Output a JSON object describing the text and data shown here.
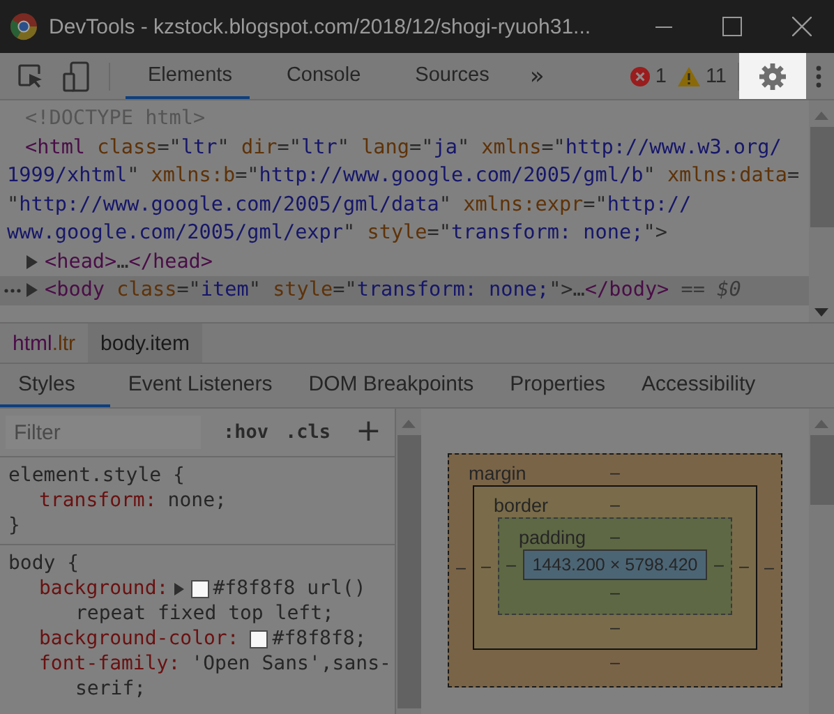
{
  "window": {
    "title": "DevTools - kzstock.blogspot.com/2018/12/shogi-ryuoh31..."
  },
  "toolbar": {
    "tabs": [
      {
        "label": "Elements",
        "selected": true
      },
      {
        "label": "Console",
        "selected": false
      },
      {
        "label": "Sources",
        "selected": false
      }
    ],
    "more": "»",
    "errors": "1",
    "warnings": "11",
    "settings_highlighted": true
  },
  "dom": [
    {
      "lines": [
        [
          {
            "kind": "doctype",
            "text": "<!DOCTYPE html>"
          }
        ]
      ]
    },
    {
      "lines": [
        [
          {
            "kind": "tag",
            "text": "<html "
          },
          {
            "kind": "attr",
            "text": "class"
          },
          {
            "kind": "punct",
            "text": "=\""
          },
          {
            "kind": "value",
            "text": "ltr"
          },
          {
            "kind": "punct",
            "text": "\" "
          },
          {
            "kind": "attr",
            "text": "dir"
          },
          {
            "kind": "punct",
            "text": "=\""
          },
          {
            "kind": "value",
            "text": "ltr"
          },
          {
            "kind": "punct",
            "text": "\" "
          },
          {
            "kind": "attr",
            "text": "lang"
          },
          {
            "kind": "punct",
            "text": "=\""
          },
          {
            "kind": "value",
            "text": "ja"
          },
          {
            "kind": "punct",
            "text": "\" "
          },
          {
            "kind": "attr",
            "text": "xmlns"
          },
          {
            "kind": "punct",
            "text": "=\""
          },
          {
            "kind": "value",
            "text": "http://www.w3.org/"
          }
        ],
        [
          {
            "kind": "value",
            "text": "1999/xhtml"
          },
          {
            "kind": "punct",
            "text": "\" "
          },
          {
            "kind": "attr",
            "text": "xmlns:b"
          },
          {
            "kind": "punct",
            "text": "=\""
          },
          {
            "kind": "value",
            "text": "http://www.google.com/2005/gml/b"
          },
          {
            "kind": "punct",
            "text": "\" "
          },
          {
            "kind": "attr",
            "text": "xmlns:data"
          },
          {
            "kind": "punct",
            "text": "="
          }
        ],
        [
          {
            "kind": "punct",
            "text": "\""
          },
          {
            "kind": "value",
            "text": "http://www.google.com/2005/gml/data"
          },
          {
            "kind": "punct",
            "text": "\" "
          },
          {
            "kind": "attr",
            "text": "xmlns:expr"
          },
          {
            "kind": "punct",
            "text": "=\""
          },
          {
            "kind": "value",
            "text": "http://"
          }
        ],
        [
          {
            "kind": "value",
            "text": "www.google.com/2005/gml/expr"
          },
          {
            "kind": "punct",
            "text": "\" "
          },
          {
            "kind": "attr",
            "text": "style"
          },
          {
            "kind": "punct",
            "text": "=\""
          },
          {
            "kind": "value",
            "text": "transform: none;"
          },
          {
            "kind": "punct",
            "text": "\">"
          }
        ]
      ],
      "children": [
        {
          "expanded": false,
          "selected": false,
          "lines": [
            [
              {
                "kind": "tag",
                "text": "<head>"
              },
              {
                "kind": "text",
                "text": "…"
              },
              {
                "kind": "tag",
                "text": "</head>"
              }
            ]
          ]
        },
        {
          "expanded": false,
          "selected": true,
          "lines": [
            [
              {
                "kind": "tag",
                "text": "<body "
              },
              {
                "kind": "attr",
                "text": "class"
              },
              {
                "kind": "punct",
                "text": "=\""
              },
              {
                "kind": "value",
                "text": "item"
              },
              {
                "kind": "punct",
                "text": "\" "
              },
              {
                "kind": "attr",
                "text": "style"
              },
              {
                "kind": "punct",
                "text": "=\""
              },
              {
                "kind": "value",
                "text": "transform: none;"
              },
              {
                "kind": "punct",
                "text": "\">"
              },
              {
                "kind": "text",
                "text": "…"
              },
              {
                "kind": "tag",
                "text": "</body>"
              },
              {
                "kind": "marker",
                "text": " == $0"
              }
            ]
          ]
        }
      ]
    }
  ],
  "breadcrumbs": [
    {
      "tag": "html",
      "cls": ".ltr",
      "selected": false
    },
    {
      "tag": "body",
      "cls": ".item",
      "selected": true
    }
  ],
  "sidebar_tabs": [
    {
      "label": "Styles",
      "selected": true
    },
    {
      "label": "Event Listeners",
      "selected": false
    },
    {
      "label": "DOM Breakpoints",
      "selected": false
    },
    {
      "label": "Properties",
      "selected": false
    },
    {
      "label": "Accessibility",
      "selected": false
    }
  ],
  "styles_toolbar": {
    "filter_placeholder": "Filter",
    "hov": ":hov",
    "cls": ".cls",
    "add": "+"
  },
  "rules": [
    {
      "selector": "element.style {",
      "declarations": [
        {
          "property": "transform:",
          "value_lines": [
            "none;"
          ]
        }
      ],
      "close": "}"
    },
    {
      "selector": "body {",
      "declarations": [
        {
          "property": "background:",
          "expandable": true,
          "color": "#f8f8f8",
          "value_lines": [
            "#f8f8f8 url()",
            "repeat fixed top left;"
          ]
        },
        {
          "property": "background-color:",
          "color": "#f8f8f8",
          "value_lines": [
            "#f8f8f8;"
          ]
        },
        {
          "property": "font-family:",
          "value_lines": [
            "'Open Sans',sans-",
            "serif;"
          ]
        }
      ]
    }
  ],
  "box_model": {
    "margin": {
      "label": "margin",
      "top": "–",
      "right": "–",
      "bottom": "–",
      "left": "–"
    },
    "border": {
      "label": "border",
      "top": "–",
      "right": "–",
      "bottom": "–",
      "left": "–"
    },
    "padding": {
      "label": "padding",
      "top": "–",
      "right": "–",
      "bottom": "–",
      "left": "–"
    },
    "content": "1443.200 × 5798.420"
  }
}
